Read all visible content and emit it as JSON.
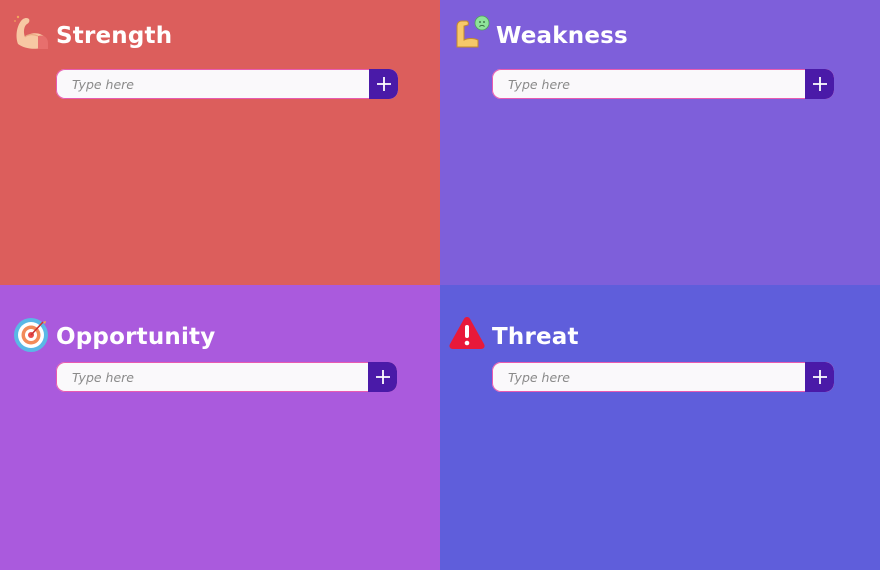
{
  "colors": {
    "strength_bg": "#dc5e5c",
    "weakness_bg": "#7e5fda",
    "opportunity_bg": "#aa5add",
    "threat_bg": "#5f5edb",
    "button_bg": "#4a1aa8",
    "input_border": "#e85bb0"
  },
  "quadrants": [
    {
      "title": "Strength",
      "icon": "flexed-biceps-icon",
      "placeholder": "Type here",
      "button_icon": "plus-icon"
    },
    {
      "title": "Weakness",
      "icon": "weak-arm-sad-face-icon",
      "placeholder": "Type here",
      "button_icon": "plus-icon"
    },
    {
      "title": "Opportunity",
      "icon": "target-dart-icon",
      "placeholder": "Type here",
      "button_icon": "plus-icon"
    },
    {
      "title": "Threat",
      "icon": "warning-triangle-icon",
      "placeholder": "Type here",
      "button_icon": "plus-icon"
    }
  ]
}
